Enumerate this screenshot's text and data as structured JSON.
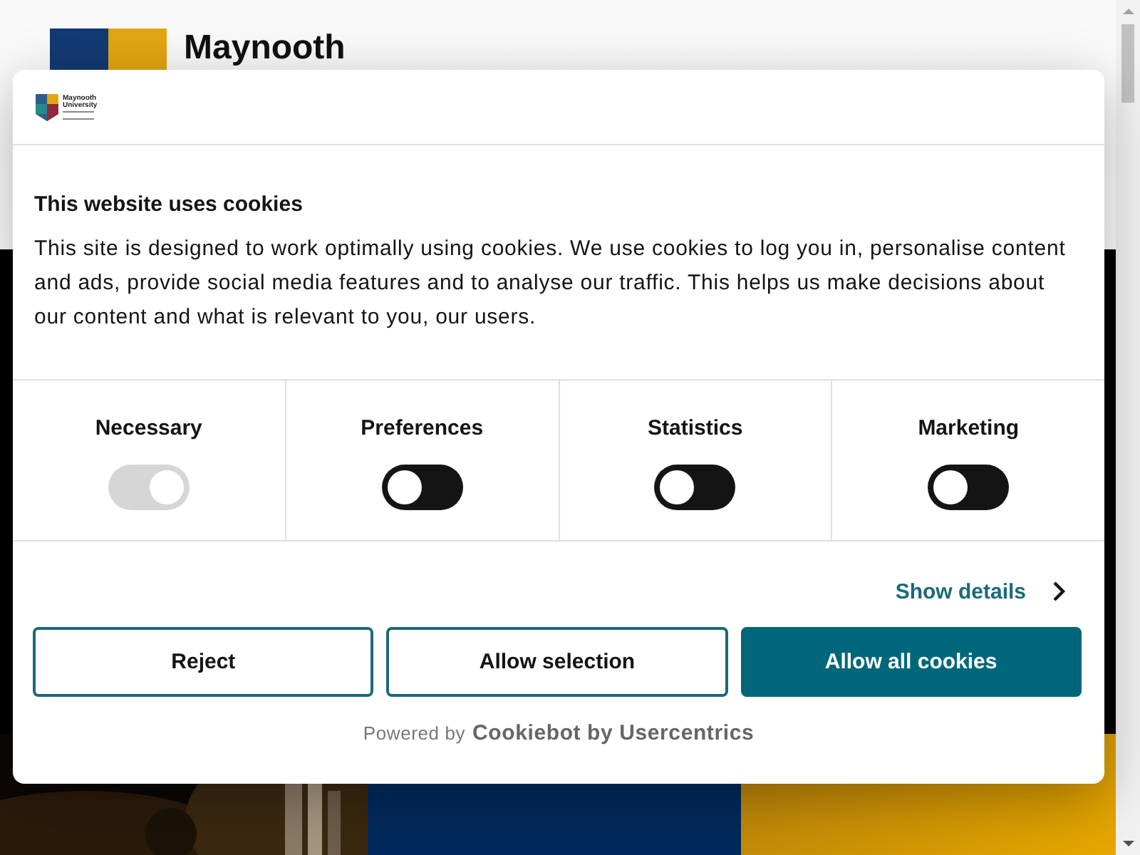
{
  "site_header": {
    "wordmark": "Maynooth"
  },
  "cookie_dialog": {
    "logo": {
      "line_1": "Maynooth",
      "line_2": "University"
    },
    "title": "This website uses cookies",
    "body": "This site is designed to work optimally using cookies. We use cookies to log you in, personalise content and ads, provide social media features and to analyse our traffic. This helps us make decisions about our content and what is relevant to you, our users.",
    "categories": [
      {
        "label": "Necessary",
        "checked": true,
        "disabled": true
      },
      {
        "label": "Preferences",
        "checked": false,
        "disabled": false
      },
      {
        "label": "Statistics",
        "checked": false,
        "disabled": false
      },
      {
        "label": "Marketing",
        "checked": false,
        "disabled": false
      }
    ],
    "details_link": "Show details",
    "buttons": [
      {
        "label": "Reject",
        "kind": "outline"
      },
      {
        "label": "Allow selection",
        "kind": "outline"
      },
      {
        "label": "Allow all cookies",
        "kind": "filled"
      }
    ],
    "footer": {
      "prefix": "Powered by",
      "brand": "Cookiebot by Usercentrics"
    }
  }
}
